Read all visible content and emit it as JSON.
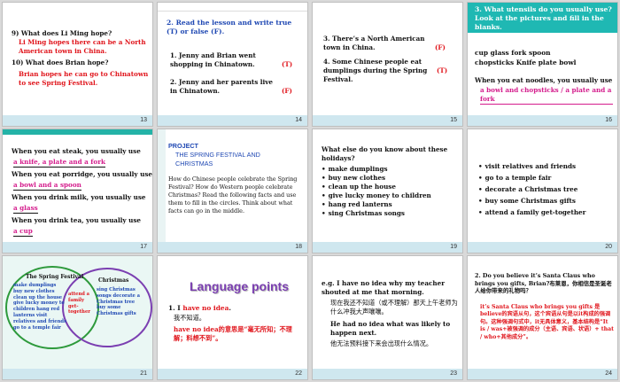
{
  "slides": [
    {
      "num": "13",
      "lines": {
        "q9": "9) What  does Li Ming hope?",
        "a9": "Li Ming hopes there can be a North American town in China.",
        "q10": "10) What does Brian hope?",
        "a10": "Brian hopes he can go to Chinatown to see Spring Festival."
      }
    },
    {
      "num": "14",
      "lines": {
        "title": "2. Read the lesson and write true (T) or false (F).",
        "s1": "1. Jenny and Brian went shopping in Chinatown.",
        "s1a": "T",
        "s2": "2. Jenny and her parents live in Chinatown.",
        "s2a": "F"
      }
    },
    {
      "num": "15",
      "lines": {
        "s3": "3. There’s a North American town in China.",
        "s3a": "F",
        "s4": "4. Some Chinese people eat dumplings during the Spring Festival.",
        "s4a": "T"
      }
    },
    {
      "num": "16",
      "lines": {
        "title": "3. What utensils do you usually use? Look at the pictures and fill in the blanks.",
        "words1": "cup   glass   fork   spoon",
        "words2": "chopsticks  Knife  plate  bowl",
        "q": "When you eat noodles, you usually use",
        "a": "a bowl and chopsticks / a plate and a fork"
      }
    },
    {
      "num": "17",
      "lines": {
        "q1": "When you eat steak, you usually use",
        "a1": "a knife, a plate and a fork",
        "q2": "When you eat porridge, you usually use",
        "a2": "a bowl and a spoon",
        "q3": "When you drink milk, you usually use",
        "a3": "a glass",
        "q4": "When you drink tea, you usually use",
        "a4": "a cup"
      }
    },
    {
      "num": "18",
      "lines": {
        "label": "PROJECT",
        "title": "THE SPRING FESTIVAL AND CHRISTMAS",
        "body": "How do Chinese people celebrate the Spring Festival? How do Western people celebrate Christmas? Read the following facts and use them to fill in the circles. Think about what facts can go in the middle."
      }
    },
    {
      "num": "19",
      "lines": {
        "q": "What  else do you know about these holidays?",
        "items": [
          "make dumplings",
          "buy new clothes",
          "clean up the house",
          "give lucky money to children",
          "hang red lanterns",
          "sing Christmas songs"
        ]
      }
    },
    {
      "num": "20",
      "lines": {
        "items": [
          "visit relatives and friends",
          "go to a temple fair",
          "decorate a Christmas tree",
          "buy some Christmas gifts",
          "attend a family  get-together"
        ]
      }
    },
    {
      "num": "21",
      "lines": {
        "left_title": "The Spring Festival",
        "left": "make dumplings buy new clothes clean up the house give lucky money to children hang red lanterns visit relatives and friends go to a temple fair",
        "mid": "attend a family get-together",
        "right_title": "Christmas",
        "right": "sing Christmas songs decorate a Christmas tree buy some Christmas gifts"
      }
    },
    {
      "num": "22",
      "lines": {
        "title": "Language points",
        "p1": "1. I have no idea.",
        "p1cn": "我不知道。",
        "note": "have no idea的意思是“毫无所知；不理解；料想不到”。"
      }
    },
    {
      "num": "23",
      "lines": {
        "eg": "e.g. I have no idea why my teacher shouted at me that morning.",
        "egcn": "现在我还不知道（或不理解）那天上午老师为什么冲我大声嚷嚷。",
        "eg2": "He had no idea what was likely to happen next.",
        "eg2cn": "他无法预料接下来会出现什么情况。"
      }
    },
    {
      "num": "24",
      "lines": {
        "p2": "2. Do you believe it’s Santa Claus who brings you gifts, Brian?布莱恩，你相信是圣诞老人给你带来的礼物吗？",
        "note": "it’s Santa Claus who brings you gifts 是believe的宾语从句，这个宾语从句是以it构成的强调句。这种强调句式中，it无具体意义，基本结构是“It is / was+被强调的成分（主语、宾语、状语）+ that / who+其他成分”。"
      }
    }
  ],
  "colors": {
    "red": "#e0141b",
    "blue": "#1f48b3",
    "pink": "#d41c8c",
    "teal": "#1fb8b3"
  }
}
